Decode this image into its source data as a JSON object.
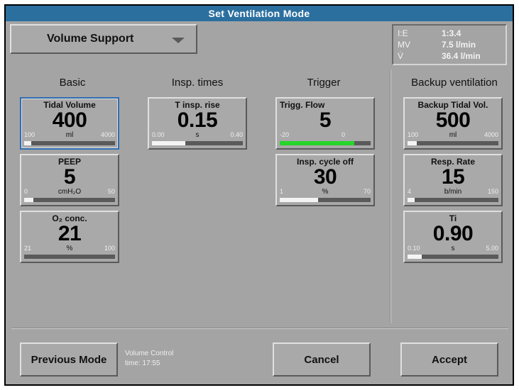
{
  "title": "Set Ventilation Mode",
  "mode": {
    "selected": "Volume Support"
  },
  "status": [
    {
      "key": "I:E",
      "value": "1:3.4"
    },
    {
      "key": "MV",
      "value": "7.5 l/min"
    },
    {
      "key": "V̇",
      "value": "36.4 l/min"
    }
  ],
  "columns": {
    "basic": "Basic",
    "insp_times": "Insp. times",
    "trigger": "Trigger",
    "backup": "Backup ventilation"
  },
  "params": {
    "tidal_volume": {
      "name": "Tidal Volume",
      "value": "400",
      "unit": "ml",
      "min": "100",
      "max": "4000",
      "level": 0.08,
      "color": "#f4f4f4"
    },
    "peep": {
      "name": "PEEP",
      "value": "5",
      "unit": "cmH₂O",
      "min": "0",
      "max": "50",
      "level": 0.1,
      "color": "#f4f4f4"
    },
    "o2_conc": {
      "name": "O₂ conc.",
      "value": "21",
      "unit": "%",
      "min": "21",
      "max": "100",
      "level": 0.0,
      "color": "#f4f4f4"
    },
    "t_insp_rise": {
      "name": "T insp. rise",
      "value": "0.15",
      "unit": "s",
      "min": "0.00",
      "max": "0.40",
      "level": 0.37,
      "color": "#f4f4f4"
    },
    "trigg_flow": {
      "name": "Trigg. Flow",
      "value": "5",
      "unit": "",
      "min": "-20",
      "max": "0",
      "level": 0.82,
      "color": "#27d42a"
    },
    "insp_cycle_off": {
      "name": "Insp. cycle off",
      "value": "30",
      "unit": "%",
      "min": "1",
      "max": "70",
      "level": 0.42,
      "color": "#f4f4f4"
    },
    "backup_tidal_vol": {
      "name": "Backup Tidal Vol.",
      "value": "500",
      "unit": "ml",
      "min": "100",
      "max": "4000",
      "level": 0.1,
      "color": "#f4f4f4"
    },
    "resp_rate": {
      "name": "Resp. Rate",
      "value": "15",
      "unit": "b/min",
      "min": "4",
      "max": "150",
      "level": 0.08,
      "color": "#f4f4f4"
    },
    "ti": {
      "name": "Ti",
      "value": "0.90",
      "unit": "s",
      "min": "0.10",
      "max": "5.00",
      "level": 0.16,
      "color": "#f4f4f4"
    }
  },
  "buttons": {
    "previous_mode": "Previous Mode",
    "cancel": "Cancel",
    "accept": "Accept"
  },
  "previous_info": {
    "mode": "Volume Control",
    "time": "time: 17:55"
  }
}
